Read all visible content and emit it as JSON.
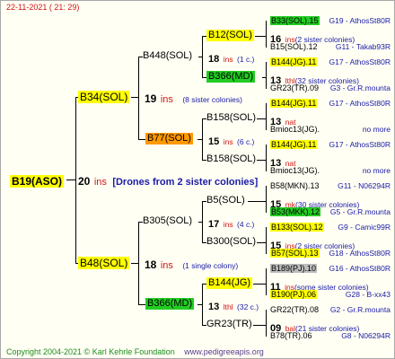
{
  "header": {
    "timestamp": "22-11-2021 ( 21: 29)"
  },
  "footer": {
    "copyright": "Copyright 2004-2021 © Karl Kehrle Foundation",
    "site": "www.pedigreeapis.org"
  },
  "root": {
    "name": "B19(ASO)",
    "count": "20",
    "unit": "ins",
    "note": "[Drones from 2 sister colonies]"
  },
  "gen1": [
    {
      "name": "B34(SOL)",
      "count": "19",
      "unit": "ins",
      "note": "(8 sister colonies)"
    },
    {
      "name": "B48(SOL)",
      "count": "18",
      "unit": "ins",
      "note": "(1 single colony)"
    }
  ],
  "gen2": [
    {
      "name": "B448(SOL)",
      "count": "18",
      "unit": "ins",
      "note": "(1 c.)"
    },
    {
      "name": "B77(SOL)",
      "count": "15",
      "unit": "ins",
      "note": "(6 c.)"
    },
    {
      "name": "B305(SOL)",
      "count": "17",
      "unit": "ins",
      "note": "(4 c.)"
    },
    {
      "name": "B366(MD)",
      "count": "13",
      "unit": "lthl",
      "note": "(32 c.)"
    }
  ],
  "gen3": [
    {
      "name": "B12(SOL)",
      "count": "16",
      "unit": "ins",
      "note": "(2 sister colonies)"
    },
    {
      "name": "B366(MD)",
      "count": "13",
      "unit": "lthl",
      "note": "(32 sister colonies)"
    },
    {
      "name": "B158(SOL)",
      "count": "13",
      "unit": "nat",
      "note": ""
    },
    {
      "name": "B158(SOL)",
      "count": "13",
      "unit": "nat",
      "note": ""
    },
    {
      "name": "B5(SOL)",
      "count": "15",
      "unit": "mk",
      "note": "(30 sister colonies)"
    },
    {
      "name": "B300(SOL)",
      "count": "15",
      "unit": "ins",
      "note": "(2 sister colonies)"
    },
    {
      "name": "B144(JG)",
      "count": "11",
      "unit": "ins",
      "note": "(some sister colonies)"
    },
    {
      "name": "GR23(TR)",
      "count": "09",
      "unit": "bal",
      "note": "(21 sister colonies)"
    }
  ],
  "gen4": [
    {
      "name": "B33(SOL).15",
      "info": "G19 - AthosSt80R"
    },
    {
      "name": "B15(SOL).12",
      "info": "G11 - Takab93R"
    },
    {
      "name": "B144(JG).11",
      "info": "G17 - AthosSt80R"
    },
    {
      "name": "GR23(TR).09",
      "info": "G3 - Gr.R.mounta"
    },
    {
      "name": "B144(JG).11",
      "info": "G17 - AthosSt80R"
    },
    {
      "name": "Bmioc13(JG).",
      "info": "no more"
    },
    {
      "name": "B144(JG).11",
      "info": "G17 - AthosSt80R"
    },
    {
      "name": "Bmioc13(JG).",
      "info": "no more"
    },
    {
      "name": "B58(MKN).13",
      "info": "G11 - N06294R"
    },
    {
      "name": "B53(MKK).12",
      "info": "G5 - Gr.R.mounta"
    },
    {
      "name": "B133(SOL).12",
      "info": "G9 - Camic99R"
    },
    {
      "name": "B57(SOL).13",
      "info": "G18 - AthosSt80R"
    },
    {
      "name": "B189(PJ).10",
      "info": "G16 - AthosSt80R"
    },
    {
      "name": "B190(PJ).06",
      "info": "G28 - B-xx43"
    },
    {
      "name": "GR22(TR).08",
      "info": "G2 - Gr.R.mounta"
    },
    {
      "name": "B78(TR).06",
      "info": "G8 - N06294R"
    }
  ],
  "colors": {
    "yellow": "#ffff00",
    "green": "#22cc22",
    "orange": "#ff9900",
    "gray": "#bcbcbc",
    "red": "#d21414",
    "blue": "#1a1aa8"
  }
}
